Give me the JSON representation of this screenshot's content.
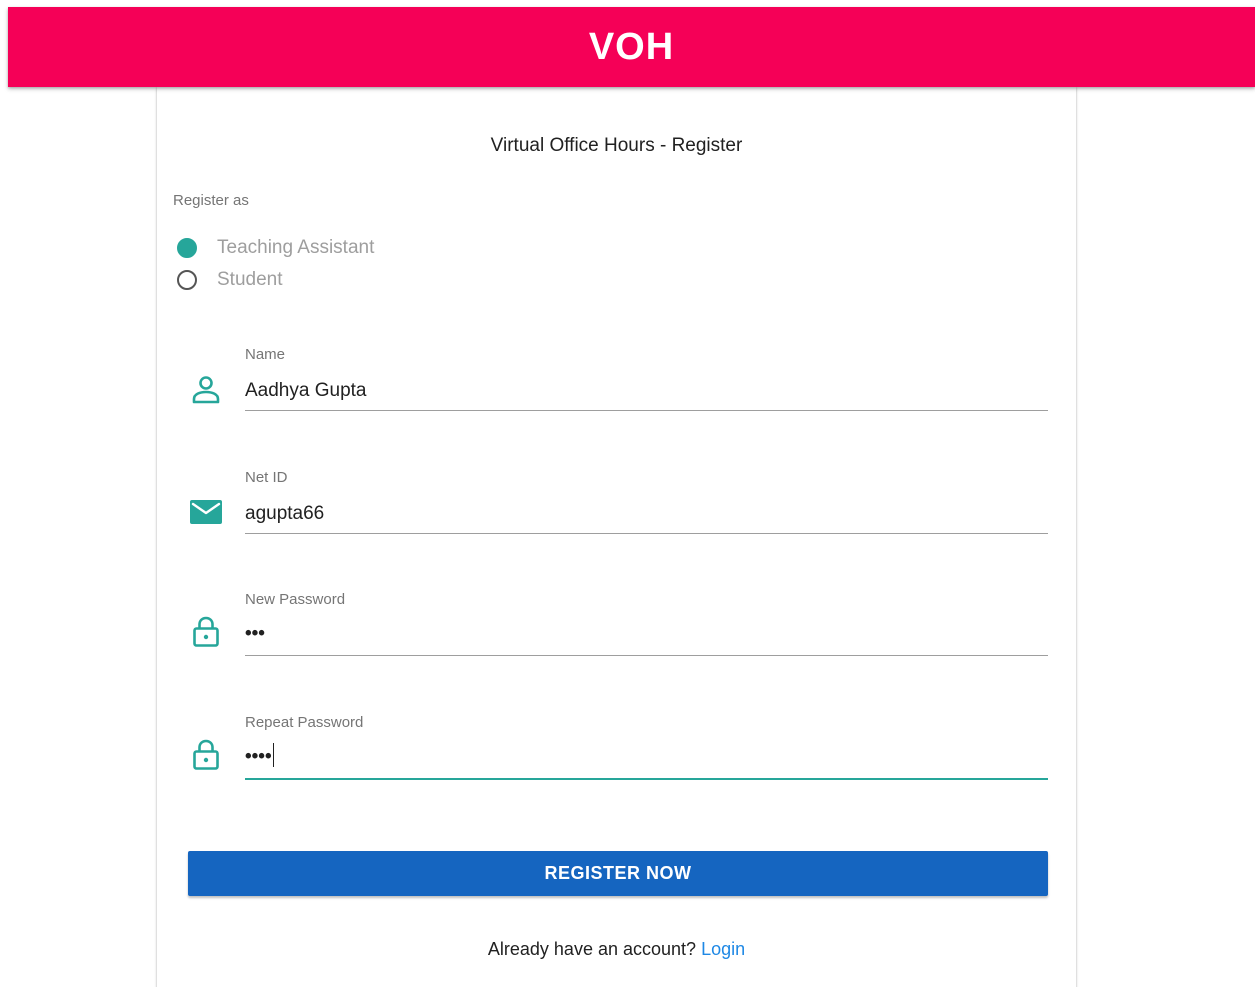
{
  "app_bar": {
    "title": "VOH",
    "color": "#f50057"
  },
  "form": {
    "title": "Virtual Office Hours - Register",
    "register_as_label": "Register as",
    "roles": [
      {
        "label": "Teaching Assistant",
        "selected": true
      },
      {
        "label": "Student",
        "selected": false
      }
    ],
    "fields": {
      "name": {
        "label": "Name",
        "value": "Aadhya Gupta",
        "icon": "person-icon"
      },
      "net_id": {
        "label": "Net ID",
        "value": "agupta66",
        "icon": "mail-icon"
      },
      "new_password": {
        "label": "New Password",
        "masked_value": "•••",
        "icon": "lock-icon"
      },
      "repeat_password": {
        "label": "Repeat Password",
        "masked_value": "••••",
        "icon": "lock-icon",
        "focused": true
      }
    },
    "submit_label": "REGISTER NOW",
    "footer_prompt": "Already have an account?",
    "login_link": "Login"
  },
  "colors": {
    "accent": "#26a69a",
    "button": "#1565c0",
    "link": "#1e88e5"
  }
}
